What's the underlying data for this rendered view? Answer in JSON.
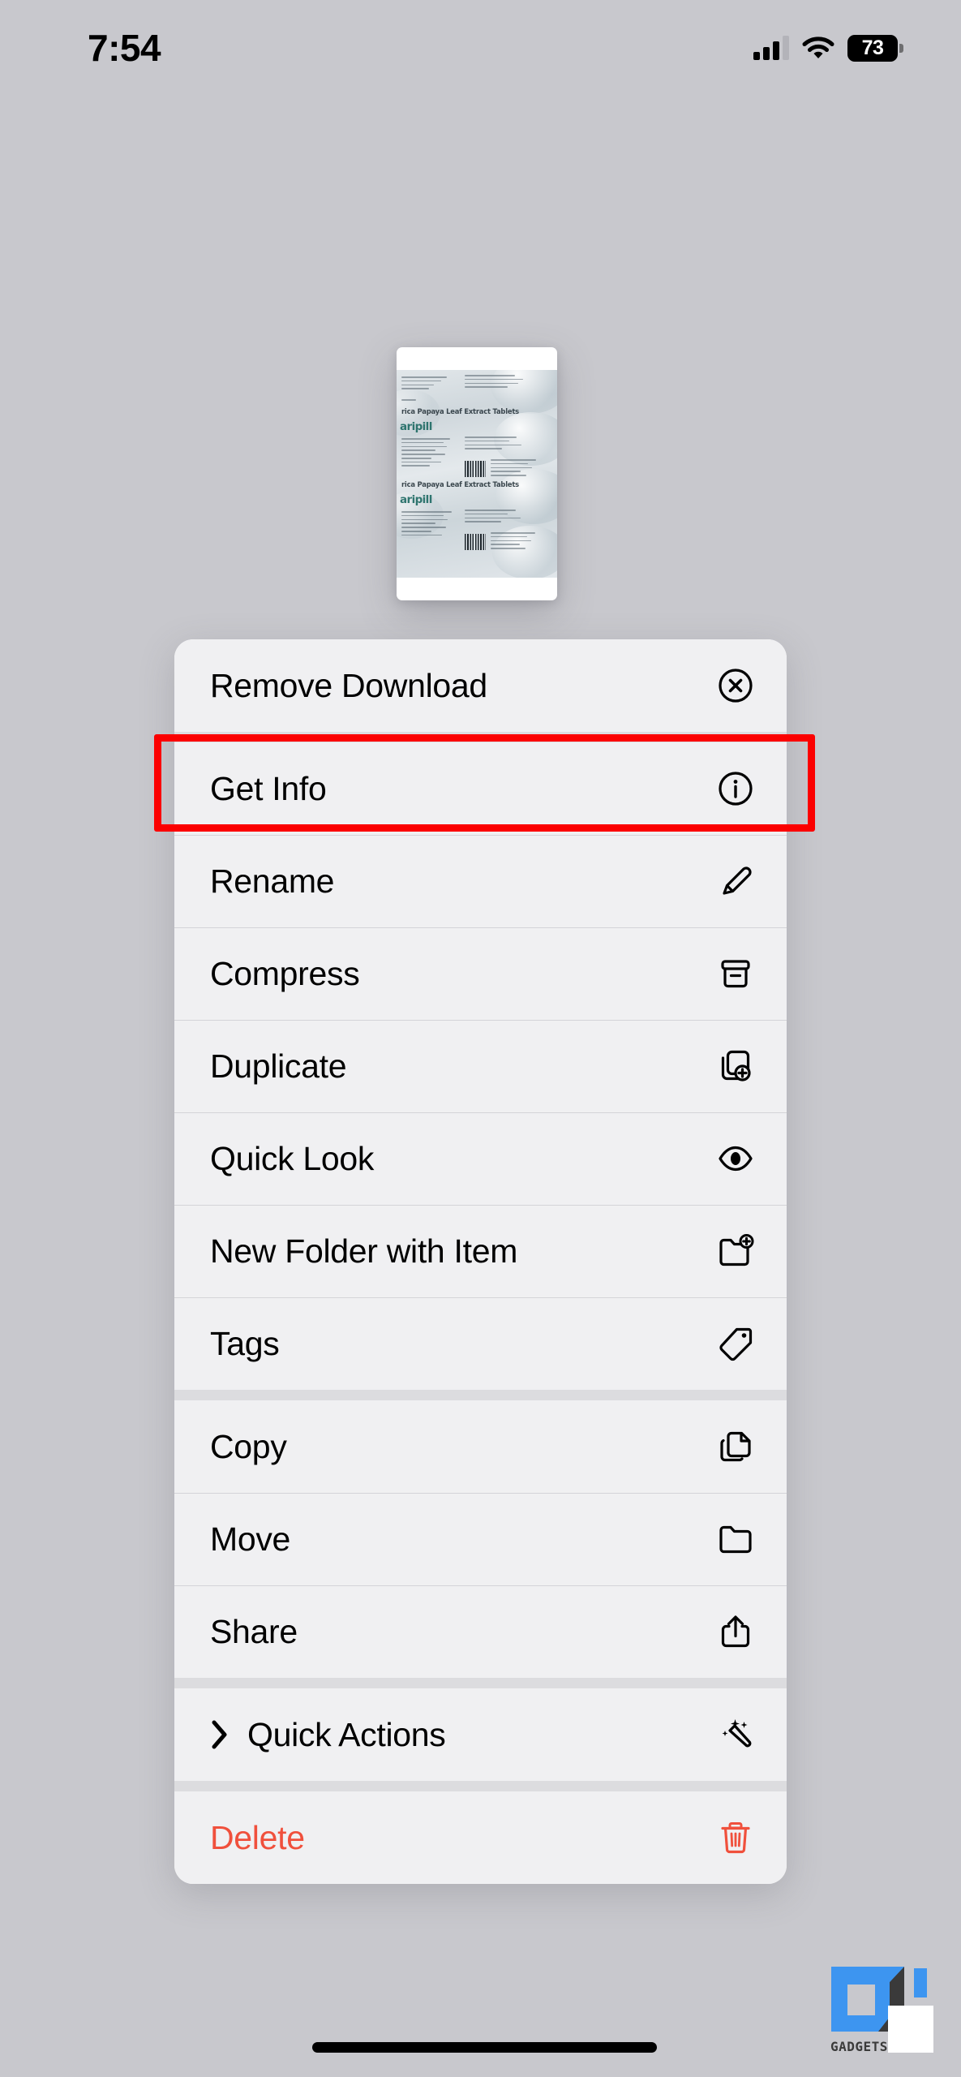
{
  "status_bar": {
    "time": "7:54",
    "battery_level": "73",
    "signal_icon": "cellular-signal-icon",
    "wifi_icon": "wifi-icon",
    "battery_icon": "battery-icon"
  },
  "preview": {
    "name": "file-thumbnail-preview",
    "product_line_1": "rica Papaya Leaf Extract Tablets",
    "product_line_2": "rica Papaya Leaf Extract Tablets",
    "brand_1": "aripill",
    "brand_2": "aripill"
  },
  "context_menu": {
    "sections": [
      {
        "items": [
          {
            "label": "Remove Download",
            "icon": "remove-download-icon",
            "destructive": false,
            "has_chevron": false
          }
        ]
      },
      {
        "items": [
          {
            "label": "Get Info",
            "icon": "info-icon",
            "destructive": false,
            "has_chevron": false
          },
          {
            "label": "Rename",
            "icon": "pencil-icon",
            "destructive": false,
            "has_chevron": false
          },
          {
            "label": "Compress",
            "icon": "archive-box-icon",
            "destructive": false,
            "has_chevron": false
          },
          {
            "label": "Duplicate",
            "icon": "duplicate-icon",
            "destructive": false,
            "has_chevron": false
          },
          {
            "label": "Quick Look",
            "icon": "eye-icon",
            "destructive": false,
            "has_chevron": false
          },
          {
            "label": "New Folder with Item",
            "icon": "folder-plus-icon",
            "destructive": false,
            "has_chevron": false
          },
          {
            "label": "Tags",
            "icon": "tag-icon",
            "destructive": false,
            "has_chevron": false
          }
        ]
      },
      {
        "items": [
          {
            "label": "Copy",
            "icon": "copy-icon",
            "destructive": false,
            "has_chevron": false
          },
          {
            "label": "Move",
            "icon": "folder-icon",
            "destructive": false,
            "has_chevron": false
          },
          {
            "label": "Share",
            "icon": "share-icon",
            "destructive": false,
            "has_chevron": false
          }
        ]
      },
      {
        "items": [
          {
            "label": "Quick Actions",
            "icon": "sparkles-wand-icon",
            "destructive": false,
            "has_chevron": true
          }
        ]
      },
      {
        "items": [
          {
            "label": "Delete",
            "icon": "trash-icon",
            "destructive": true,
            "has_chevron": false
          }
        ]
      }
    ]
  },
  "annotation": {
    "name": "get-info-highlight",
    "target_label": "Get Info",
    "color": "#fb0000"
  },
  "watermark": {
    "text": "GADGETS",
    "brand_blue": "#3d95f0",
    "brand_dark": "#3a3a3a"
  },
  "colors": {
    "page_background": "#c8c8cd",
    "menu_row": "#f0f0f2",
    "menu_separator": "#dcdcdf",
    "destructive": "#f0503c"
  }
}
